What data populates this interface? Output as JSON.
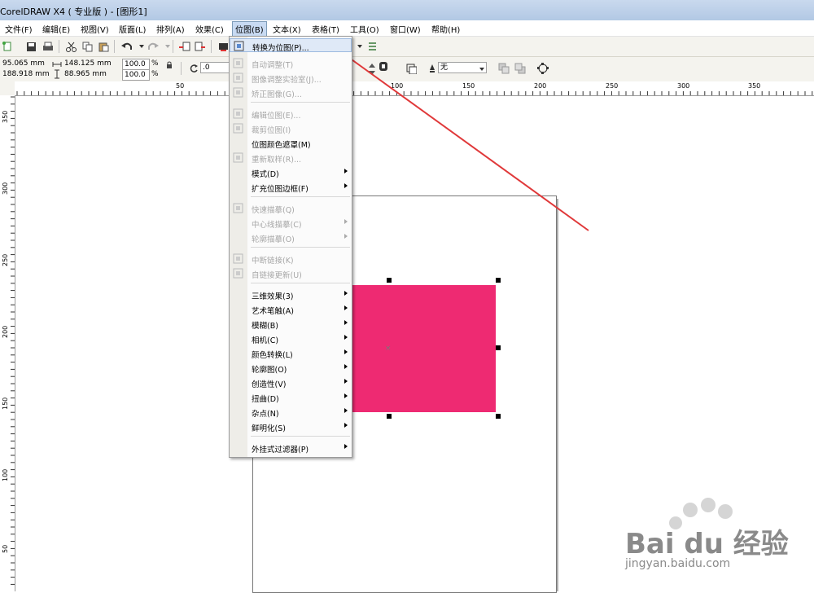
{
  "window": {
    "title": "CorelDRAW X4 ( 专业版 ) - [图形1]"
  },
  "menubar": {
    "items": [
      {
        "label": "文件(F)"
      },
      {
        "label": "编辑(E)"
      },
      {
        "label": "视图(V)"
      },
      {
        "label": "版面(L)"
      },
      {
        "label": "排列(A)"
      },
      {
        "label": "效果(C)"
      },
      {
        "label": "位图(B)"
      },
      {
        "label": "文本(X)"
      },
      {
        "label": "表格(T)"
      },
      {
        "label": "工具(O)"
      },
      {
        "label": "窗口(W)"
      },
      {
        "label": "帮助(H)"
      }
    ]
  },
  "properties": {
    "x": "95.065 mm",
    "y": "188.918 mm",
    "width": "148.125 mm",
    "height": "88.965 mm",
    "scale_x": "100.0",
    "scale_y": "100.0",
    "percent": "%",
    "rotation": ".0",
    "outline": "无"
  },
  "ruler": {
    "h_labels": [
      "50",
      "100",
      "150",
      "200",
      "250",
      "300",
      "350"
    ],
    "v_labels": [
      "350",
      "300",
      "250",
      "200",
      "150",
      "100",
      "50"
    ]
  },
  "bitmap_menu": {
    "items": [
      {
        "label": "转换为位图(P)...",
        "enabled": true,
        "icon": "convert-bitmap-icon"
      },
      {
        "label": "自动调整(T)",
        "enabled": false,
        "icon": "auto-adjust-icon"
      },
      {
        "label": "图像调整实验室(J)...",
        "enabled": false,
        "icon": "image-lab-icon"
      },
      {
        "label": "矫正图像(G)...",
        "enabled": false,
        "icon": "straighten-icon"
      },
      {
        "label": "编辑位图(E)...",
        "enabled": false,
        "icon": "edit-bitmap-icon"
      },
      {
        "label": "裁剪位图(I)",
        "enabled": false,
        "icon": "crop-bitmap-icon"
      },
      {
        "label": "位图颜色遮罩(M)",
        "enabled": true,
        "icon": ""
      },
      {
        "label": "重新取样(R)...",
        "enabled": false,
        "icon": "resample-icon"
      },
      {
        "label": "模式(D)",
        "enabled": true,
        "icon": ""
      },
      {
        "label": "扩充位图边框(F)",
        "enabled": true,
        "icon": ""
      },
      {
        "label": "快速描摹(Q)",
        "enabled": false,
        "icon": "quick-trace-icon"
      },
      {
        "label": "中心线描摹(C)",
        "enabled": false,
        "icon": ""
      },
      {
        "label": "轮廓描摹(O)",
        "enabled": false,
        "icon": ""
      },
      {
        "label": "中断链接(K)",
        "enabled": false,
        "icon": "break-link-icon"
      },
      {
        "label": "自链接更新(U)",
        "enabled": false,
        "icon": "link-update-icon"
      },
      {
        "label": "三维效果(3)",
        "enabled": true,
        "icon": ""
      },
      {
        "label": "艺术笔触(A)",
        "enabled": true,
        "icon": ""
      },
      {
        "label": "模糊(B)",
        "enabled": true,
        "icon": ""
      },
      {
        "label": "相机(C)",
        "enabled": true,
        "icon": ""
      },
      {
        "label": "颜色转换(L)",
        "enabled": true,
        "icon": ""
      },
      {
        "label": "轮廓图(O)",
        "enabled": true,
        "icon": ""
      },
      {
        "label": "创造性(V)",
        "enabled": true,
        "icon": ""
      },
      {
        "label": "扭曲(D)",
        "enabled": true,
        "icon": ""
      },
      {
        "label": "杂点(N)",
        "enabled": true,
        "icon": ""
      },
      {
        "label": "鲜明化(S)",
        "enabled": true,
        "icon": ""
      },
      {
        "label": "外挂式过滤器(P)",
        "enabled": true,
        "icon": ""
      }
    ]
  },
  "shape": {
    "fill_color": "#ee2a72"
  },
  "watermark": {
    "brand": "Bai du 经验",
    "url": "jingyan.baidu.com"
  },
  "colors": {
    "arrow": "#e0393a",
    "menu_highlight": "#dfe9f7"
  }
}
